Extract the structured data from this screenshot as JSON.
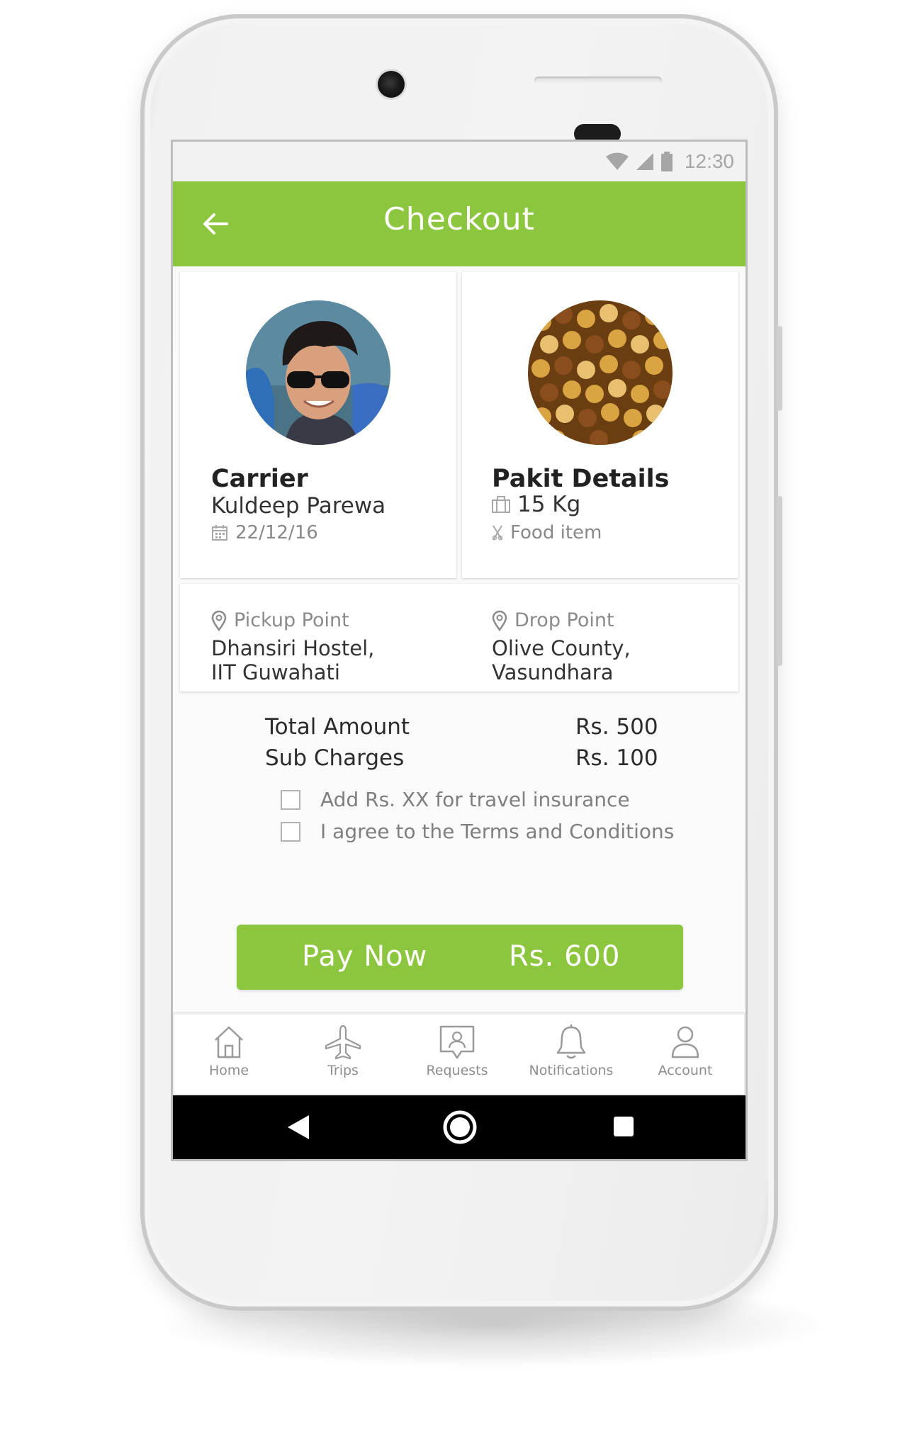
{
  "status_bar": {
    "time": "12:30",
    "icons": [
      "wifi-icon",
      "signal-icon",
      "battery-icon"
    ]
  },
  "app_bar": {
    "title": "Checkout",
    "back_icon": "arrow-left-icon"
  },
  "carrier": {
    "heading": "Carrier",
    "name": "Kuldeep Parewa",
    "date": "22/12/16",
    "date_icon": "calendar-icon"
  },
  "package": {
    "heading": "Pakit Details",
    "weight": "15 Kg",
    "weight_icon": "suitcase-icon",
    "category": "Food item",
    "category_icon": "cutlery-icon"
  },
  "pickup": {
    "label": "Pickup Point",
    "address_line1": "Dhansiri Hostel,",
    "address_line2": "IIT Guwahati"
  },
  "drop": {
    "label": "Drop Point",
    "address_line1": "Olive County,",
    "address_line2": "Vasundhara"
  },
  "charges": {
    "total_label": "Total Amount",
    "total_value": "Rs. 500",
    "sub_label": "Sub Charges",
    "sub_value": "Rs. 100"
  },
  "options": {
    "insurance": {
      "label": "Add Rs. XX for travel insurance",
      "checked": false
    },
    "terms": {
      "label": "I agree to the Terms and Conditions",
      "checked": false
    }
  },
  "pay_button": {
    "label": "Pay Now",
    "amount": "Rs. 600"
  },
  "bottom_nav": [
    {
      "label": "Home",
      "icon": "home-icon"
    },
    {
      "label": "Trips",
      "icon": "airplane-icon"
    },
    {
      "label": "Requests",
      "icon": "requests-icon"
    },
    {
      "label": "Notifications",
      "icon": "bell-icon"
    },
    {
      "label": "Account",
      "icon": "person-icon"
    }
  ],
  "colors": {
    "accent": "#8cc63f",
    "screen_bg": "#fafafa",
    "text_muted": "#8a8a8a"
  }
}
